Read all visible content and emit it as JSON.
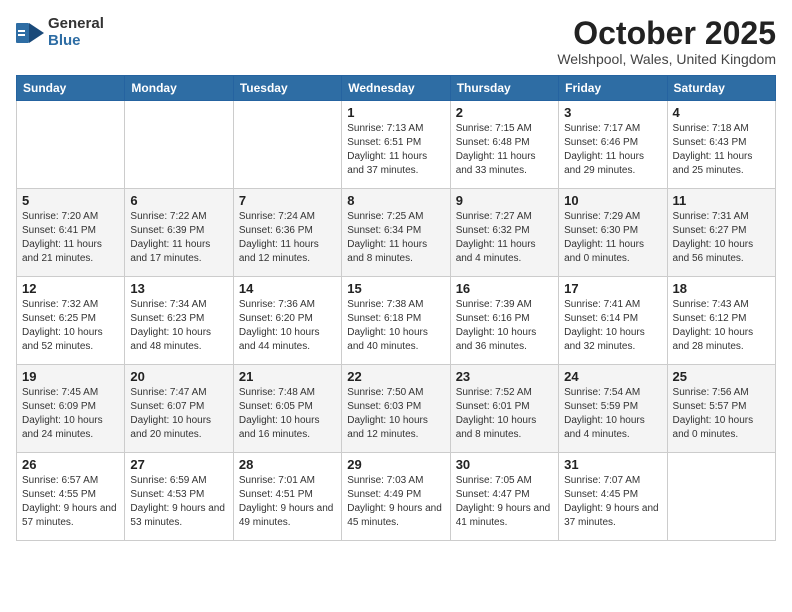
{
  "header": {
    "logo_general": "General",
    "logo_blue": "Blue",
    "month_title": "October 2025",
    "location": "Welshpool, Wales, United Kingdom"
  },
  "weekdays": [
    "Sunday",
    "Monday",
    "Tuesday",
    "Wednesday",
    "Thursday",
    "Friday",
    "Saturday"
  ],
  "weeks": [
    [
      {
        "day": "",
        "sunrise": "",
        "sunset": "",
        "daylight": ""
      },
      {
        "day": "",
        "sunrise": "",
        "sunset": "",
        "daylight": ""
      },
      {
        "day": "",
        "sunrise": "",
        "sunset": "",
        "daylight": ""
      },
      {
        "day": "1",
        "sunrise": "Sunrise: 7:13 AM",
        "sunset": "Sunset: 6:51 PM",
        "daylight": "Daylight: 11 hours and 37 minutes."
      },
      {
        "day": "2",
        "sunrise": "Sunrise: 7:15 AM",
        "sunset": "Sunset: 6:48 PM",
        "daylight": "Daylight: 11 hours and 33 minutes."
      },
      {
        "day": "3",
        "sunrise": "Sunrise: 7:17 AM",
        "sunset": "Sunset: 6:46 PM",
        "daylight": "Daylight: 11 hours and 29 minutes."
      },
      {
        "day": "4",
        "sunrise": "Sunrise: 7:18 AM",
        "sunset": "Sunset: 6:43 PM",
        "daylight": "Daylight: 11 hours and 25 minutes."
      }
    ],
    [
      {
        "day": "5",
        "sunrise": "Sunrise: 7:20 AM",
        "sunset": "Sunset: 6:41 PM",
        "daylight": "Daylight: 11 hours and 21 minutes."
      },
      {
        "day": "6",
        "sunrise": "Sunrise: 7:22 AM",
        "sunset": "Sunset: 6:39 PM",
        "daylight": "Daylight: 11 hours and 17 minutes."
      },
      {
        "day": "7",
        "sunrise": "Sunrise: 7:24 AM",
        "sunset": "Sunset: 6:36 PM",
        "daylight": "Daylight: 11 hours and 12 minutes."
      },
      {
        "day": "8",
        "sunrise": "Sunrise: 7:25 AM",
        "sunset": "Sunset: 6:34 PM",
        "daylight": "Daylight: 11 hours and 8 minutes."
      },
      {
        "day": "9",
        "sunrise": "Sunrise: 7:27 AM",
        "sunset": "Sunset: 6:32 PM",
        "daylight": "Daylight: 11 hours and 4 minutes."
      },
      {
        "day": "10",
        "sunrise": "Sunrise: 7:29 AM",
        "sunset": "Sunset: 6:30 PM",
        "daylight": "Daylight: 11 hours and 0 minutes."
      },
      {
        "day": "11",
        "sunrise": "Sunrise: 7:31 AM",
        "sunset": "Sunset: 6:27 PM",
        "daylight": "Daylight: 10 hours and 56 minutes."
      }
    ],
    [
      {
        "day": "12",
        "sunrise": "Sunrise: 7:32 AM",
        "sunset": "Sunset: 6:25 PM",
        "daylight": "Daylight: 10 hours and 52 minutes."
      },
      {
        "day": "13",
        "sunrise": "Sunrise: 7:34 AM",
        "sunset": "Sunset: 6:23 PM",
        "daylight": "Daylight: 10 hours and 48 minutes."
      },
      {
        "day": "14",
        "sunrise": "Sunrise: 7:36 AM",
        "sunset": "Sunset: 6:20 PM",
        "daylight": "Daylight: 10 hours and 44 minutes."
      },
      {
        "day": "15",
        "sunrise": "Sunrise: 7:38 AM",
        "sunset": "Sunset: 6:18 PM",
        "daylight": "Daylight: 10 hours and 40 minutes."
      },
      {
        "day": "16",
        "sunrise": "Sunrise: 7:39 AM",
        "sunset": "Sunset: 6:16 PM",
        "daylight": "Daylight: 10 hours and 36 minutes."
      },
      {
        "day": "17",
        "sunrise": "Sunrise: 7:41 AM",
        "sunset": "Sunset: 6:14 PM",
        "daylight": "Daylight: 10 hours and 32 minutes."
      },
      {
        "day": "18",
        "sunrise": "Sunrise: 7:43 AM",
        "sunset": "Sunset: 6:12 PM",
        "daylight": "Daylight: 10 hours and 28 minutes."
      }
    ],
    [
      {
        "day": "19",
        "sunrise": "Sunrise: 7:45 AM",
        "sunset": "Sunset: 6:09 PM",
        "daylight": "Daylight: 10 hours and 24 minutes."
      },
      {
        "day": "20",
        "sunrise": "Sunrise: 7:47 AM",
        "sunset": "Sunset: 6:07 PM",
        "daylight": "Daylight: 10 hours and 20 minutes."
      },
      {
        "day": "21",
        "sunrise": "Sunrise: 7:48 AM",
        "sunset": "Sunset: 6:05 PM",
        "daylight": "Daylight: 10 hours and 16 minutes."
      },
      {
        "day": "22",
        "sunrise": "Sunrise: 7:50 AM",
        "sunset": "Sunset: 6:03 PM",
        "daylight": "Daylight: 10 hours and 12 minutes."
      },
      {
        "day": "23",
        "sunrise": "Sunrise: 7:52 AM",
        "sunset": "Sunset: 6:01 PM",
        "daylight": "Daylight: 10 hours and 8 minutes."
      },
      {
        "day": "24",
        "sunrise": "Sunrise: 7:54 AM",
        "sunset": "Sunset: 5:59 PM",
        "daylight": "Daylight: 10 hours and 4 minutes."
      },
      {
        "day": "25",
        "sunrise": "Sunrise: 7:56 AM",
        "sunset": "Sunset: 5:57 PM",
        "daylight": "Daylight: 10 hours and 0 minutes."
      }
    ],
    [
      {
        "day": "26",
        "sunrise": "Sunrise: 6:57 AM",
        "sunset": "Sunset: 4:55 PM",
        "daylight": "Daylight: 9 hours and 57 minutes."
      },
      {
        "day": "27",
        "sunrise": "Sunrise: 6:59 AM",
        "sunset": "Sunset: 4:53 PM",
        "daylight": "Daylight: 9 hours and 53 minutes."
      },
      {
        "day": "28",
        "sunrise": "Sunrise: 7:01 AM",
        "sunset": "Sunset: 4:51 PM",
        "daylight": "Daylight: 9 hours and 49 minutes."
      },
      {
        "day": "29",
        "sunrise": "Sunrise: 7:03 AM",
        "sunset": "Sunset: 4:49 PM",
        "daylight": "Daylight: 9 hours and 45 minutes."
      },
      {
        "day": "30",
        "sunrise": "Sunrise: 7:05 AM",
        "sunset": "Sunset: 4:47 PM",
        "daylight": "Daylight: 9 hours and 41 minutes."
      },
      {
        "day": "31",
        "sunrise": "Sunrise: 7:07 AM",
        "sunset": "Sunset: 4:45 PM",
        "daylight": "Daylight: 9 hours and 37 minutes."
      },
      {
        "day": "",
        "sunrise": "",
        "sunset": "",
        "daylight": ""
      }
    ]
  ]
}
